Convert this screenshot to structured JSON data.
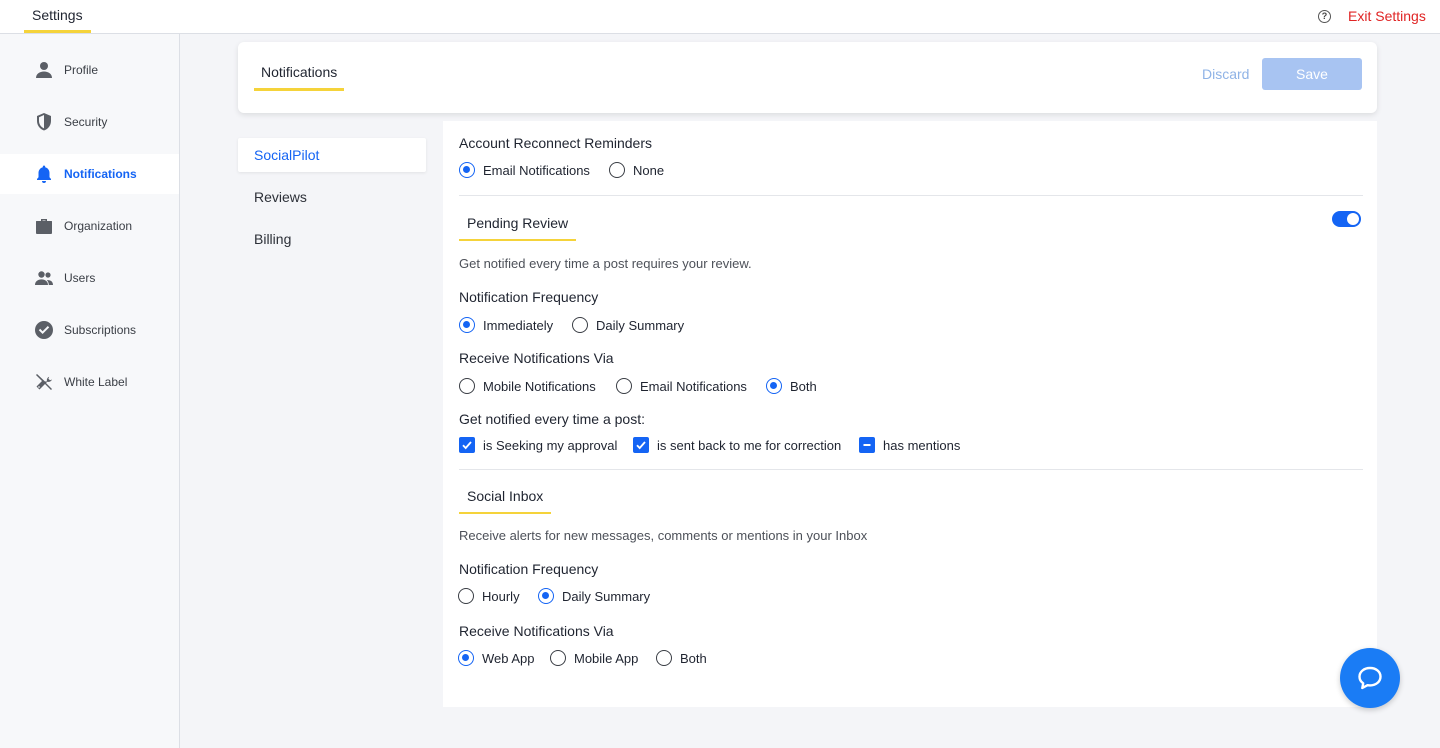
{
  "topbar": {
    "title": "Settings",
    "help_icon": "question-circle-icon",
    "exit_label": "Exit Settings"
  },
  "sidebar": {
    "items": [
      {
        "label": "Profile",
        "icon": "user-icon",
        "active": false
      },
      {
        "label": "Security",
        "icon": "shield-icon",
        "active": false
      },
      {
        "label": "Notifications",
        "icon": "bell-icon",
        "active": true
      },
      {
        "label": "Organization",
        "icon": "briefcase-icon",
        "active": false
      },
      {
        "label": "Users",
        "icon": "users-icon",
        "active": false
      },
      {
        "label": "Subscriptions",
        "icon": "check-circle-icon",
        "active": false
      },
      {
        "label": "White Label",
        "icon": "tools-icon",
        "active": false
      }
    ]
  },
  "header": {
    "tab_label": "Notifications",
    "discard_label": "Discard",
    "save_label": "Save"
  },
  "subnav": {
    "items": [
      {
        "label": "SocialPilot",
        "active": true
      },
      {
        "label": "Reviews",
        "active": false
      },
      {
        "label": "Billing",
        "active": false
      }
    ]
  },
  "account_reconnect": {
    "title": "Account Reconnect Reminders",
    "options": [
      {
        "label": "Email Notifications",
        "selected": true
      },
      {
        "label": "None",
        "selected": false
      }
    ]
  },
  "pending_review": {
    "title": "Pending Review",
    "enabled": true,
    "description": "Get notified every time a post requires your review.",
    "frequency_label": "Notification Frequency",
    "frequency_options": [
      {
        "label": "Immediately",
        "selected": true
      },
      {
        "label": "Daily Summary",
        "selected": false
      }
    ],
    "via_label": "Receive Notifications Via",
    "via_options": [
      {
        "label": "Mobile Notifications",
        "selected": false
      },
      {
        "label": "Email Notifications",
        "selected": false
      },
      {
        "label": "Both",
        "selected": true
      }
    ],
    "post_label": "Get notified every time a post:",
    "post_options": [
      {
        "label": "is Seeking my approval",
        "state": "checked"
      },
      {
        "label": "is sent back to me for correction",
        "state": "checked"
      },
      {
        "label": "has mentions",
        "state": "indeterminate"
      }
    ]
  },
  "social_inbox": {
    "title": "Social Inbox",
    "description": "Receive alerts for new messages, comments or  mentions in your Inbox",
    "frequency_label": "Notification Frequency",
    "frequency_options": [
      {
        "label": "Hourly",
        "selected": false
      },
      {
        "label": "Daily Summary",
        "selected": true
      }
    ],
    "via_label": "Receive Notifications Via",
    "via_options": [
      {
        "label": "Web App",
        "selected": true
      },
      {
        "label": "Mobile App",
        "selected": false
      },
      {
        "label": "Both",
        "selected": false
      }
    ]
  },
  "chat": {
    "icon": "chat-bubble-icon"
  },
  "colors": {
    "accent": "#1464f4",
    "underline": "#f5d33a",
    "exit": "#e02424"
  }
}
